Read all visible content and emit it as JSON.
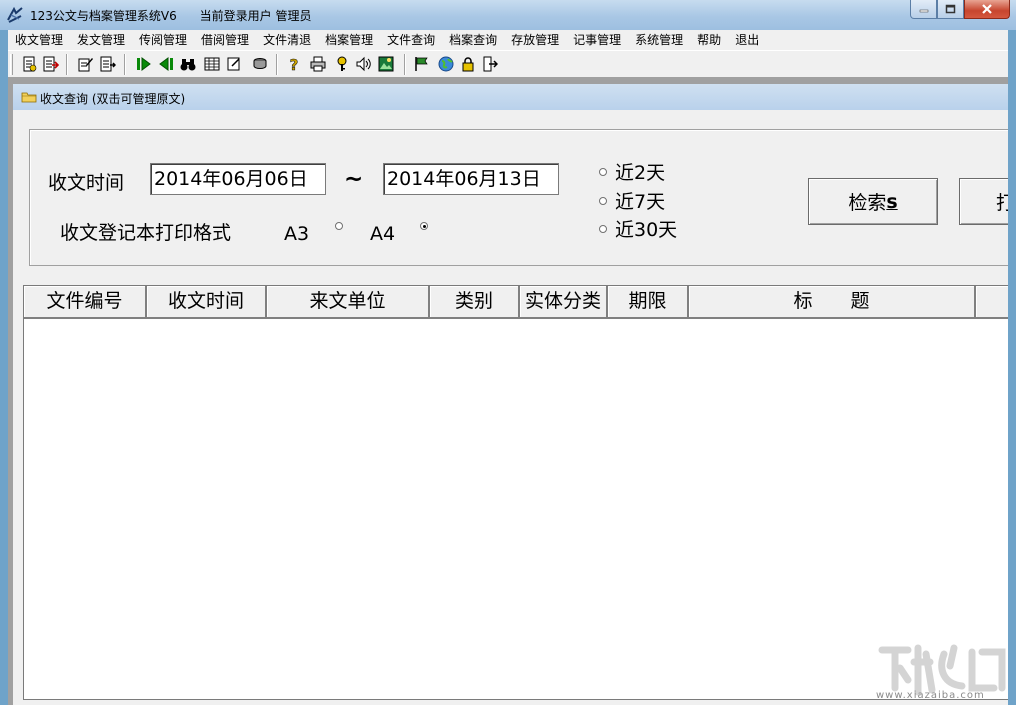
{
  "window": {
    "title": "123公文与档案管理系统V6",
    "current_user_label": "当前登录用户",
    "current_user": "管理员"
  },
  "menu": [
    "收文管理",
    "发文管理",
    "传阅管理",
    "借阅管理",
    "文件清退",
    "档案管理",
    "文件查询",
    "档案查询",
    "存放管理",
    "记事管理",
    "系统管理",
    "帮助",
    "退出"
  ],
  "child_window": {
    "title": "收文查询 (双击可管理原文)"
  },
  "search": {
    "time_label": "收文时间",
    "date_from": "2014年06月06日",
    "range_sep": "~",
    "date_to": "2014年06月13日",
    "print_format_label": "收文登记本打印格式",
    "format_a3": "A3",
    "format_a4": "A4",
    "format_selected": "A4",
    "quick_ranges": [
      "近2天",
      "近7天",
      "近30天"
    ],
    "search_button": "检索",
    "search_hotkey": "s",
    "second_button": "打"
  },
  "table": {
    "columns": [
      "文件编号",
      "收文时间",
      "来文单位",
      "类别",
      "实体分类",
      "期限",
      "标　　题",
      ""
    ],
    "rows": []
  },
  "watermark": {
    "sub": "www.xiazaiba.com"
  },
  "icons": {
    "toolbar": [
      "new-doc-icon",
      "exit-doc-icon",
      "edit-doc-icon",
      "export-icon",
      "forward-icon",
      "back-icon",
      "binoculars-icon",
      "table-icon",
      "note-icon",
      "stack-icon",
      "help-icon",
      "print-icon",
      "key-icon",
      "speaker-icon",
      "image-icon",
      "flag-icon",
      "globe-icon",
      "lock-icon",
      "logout-icon"
    ]
  }
}
